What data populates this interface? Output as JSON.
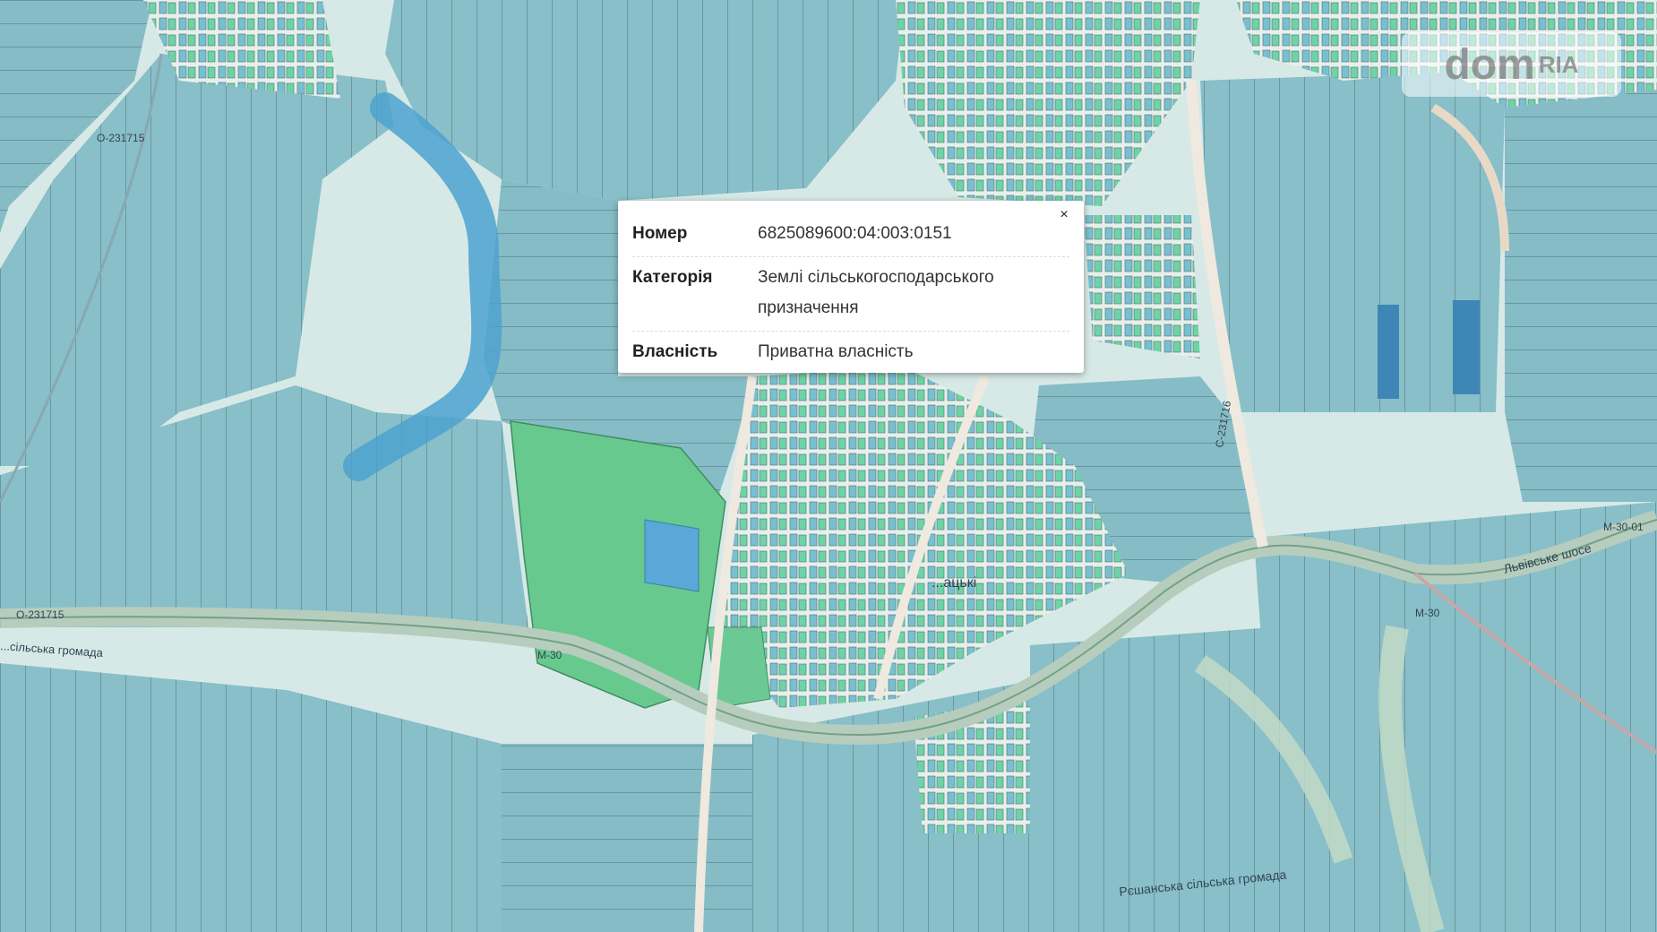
{
  "map": {
    "road_labels": [
      "О-231715",
      "О-231715",
      "М-30",
      "С-231716",
      "Львівське шосе",
      "М-30-01",
      "М-30"
    ],
    "community_labels": [
      "Рєшанська сільська громада",
      "...сільська громада"
    ],
    "settlement_label": "...ацькі"
  },
  "popup": {
    "close_glyph": "×",
    "rows": [
      {
        "label": "Номер",
        "value": "6825089600:04:003:0151"
      },
      {
        "label": "Категорія",
        "value": "Землі сільськогосподарського призначення"
      },
      {
        "label": "Власність",
        "value": "Приватна власність"
      }
    ]
  },
  "logo": {
    "main": "dom",
    "suffix": "RIA"
  },
  "colors": {
    "parcel": "#7fb8c4",
    "parcel_green": "#6cd3a8",
    "road": "#b9c9c2",
    "background": "#d7e9e6"
  }
}
